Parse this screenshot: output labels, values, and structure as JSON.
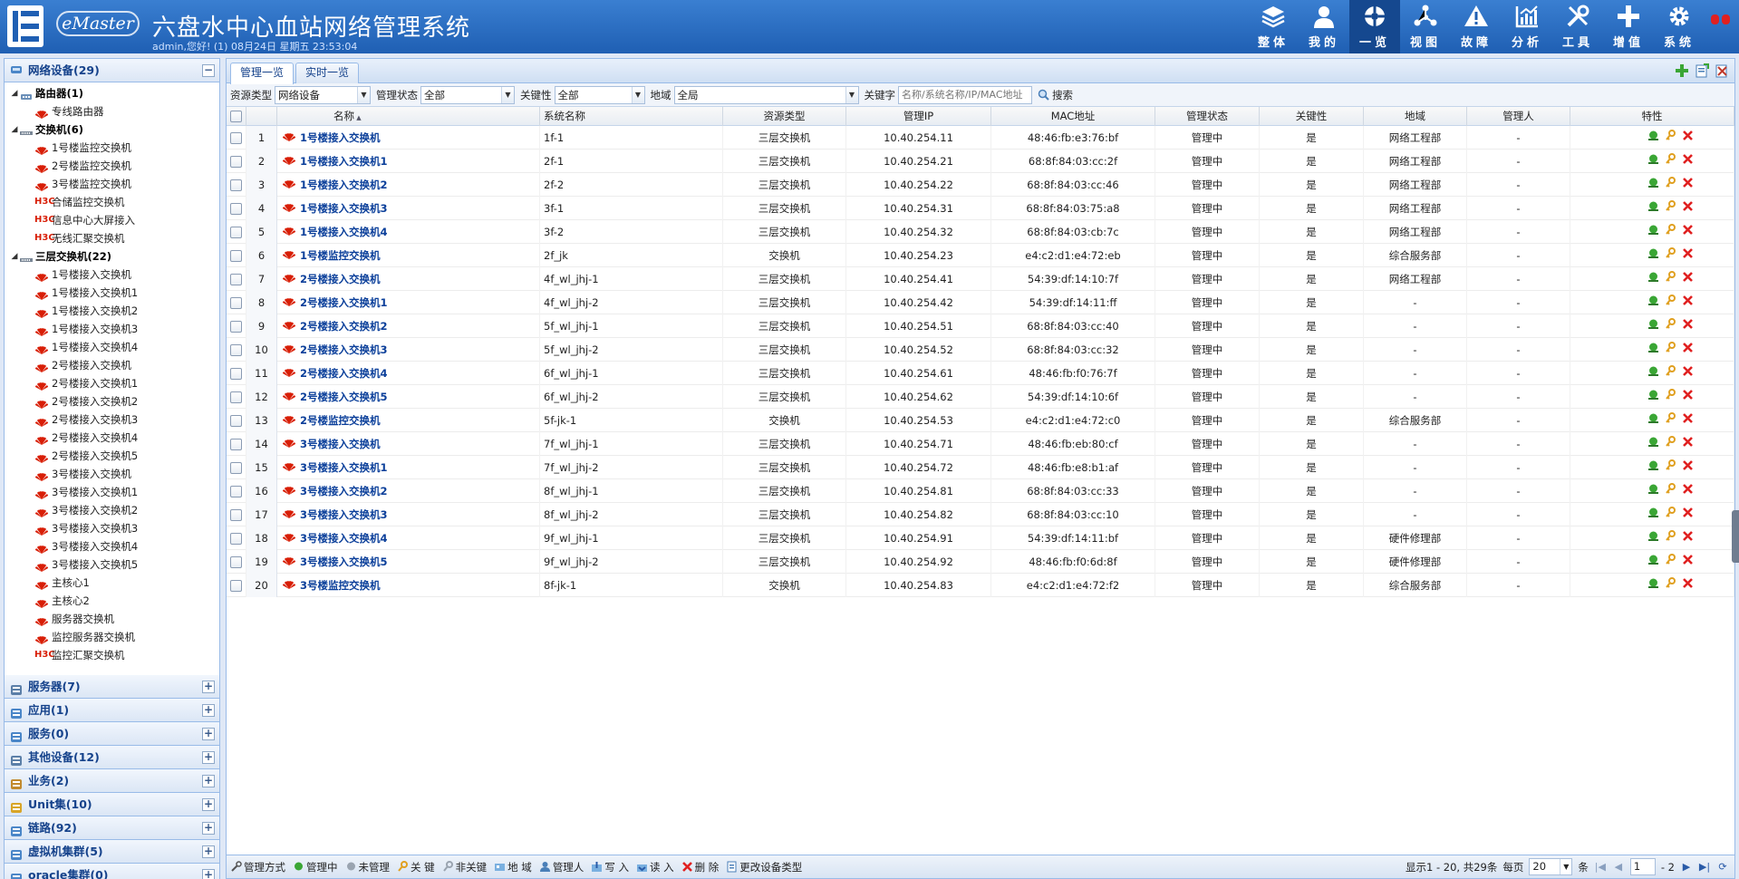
{
  "header": {
    "logo_text": "eMaster",
    "title": "六盘水中心血站网络管理系统",
    "user_info": "admin,您好! (1) 08月24日 星期五 23:53:04",
    "nav": [
      {
        "label": "整体",
        "icon": "layers-icon"
      },
      {
        "label": "我的",
        "icon": "user-icon"
      },
      {
        "label": "一览",
        "icon": "overview-icon",
        "active": true
      },
      {
        "label": "视图",
        "icon": "topology-icon"
      },
      {
        "label": "故障",
        "icon": "warning-icon"
      },
      {
        "label": "分析",
        "icon": "chart-icon"
      },
      {
        "label": "工具",
        "icon": "tools-icon"
      },
      {
        "label": "增值",
        "icon": "plus-icon"
      },
      {
        "label": "系统",
        "icon": "gear-icon"
      }
    ]
  },
  "sidebar": {
    "sections": [
      {
        "label": "网络设备(29)",
        "expanded": true
      },
      {
        "label": "服务器(7)"
      },
      {
        "label": "应用(1)"
      },
      {
        "label": "服务(0)"
      },
      {
        "label": "其他设备(12)"
      },
      {
        "label": "业务(2)"
      },
      {
        "label": "Unit集(10)"
      },
      {
        "label": "链路(92)"
      },
      {
        "label": "虚拟机集群(5)"
      },
      {
        "label": "oracle集群(0)"
      }
    ],
    "tree": [
      {
        "label": "路由器(1)",
        "type": "group",
        "icon": "router"
      },
      {
        "label": "专线路由器",
        "type": "leaf",
        "brand": "huawei"
      },
      {
        "label": "交换机(6)",
        "type": "group",
        "icon": "switch"
      },
      {
        "label": "1号楼监控交换机",
        "type": "leaf",
        "brand": "huawei"
      },
      {
        "label": "2号楼监控交换机",
        "type": "leaf",
        "brand": "huawei"
      },
      {
        "label": "3号楼监控交换机",
        "type": "leaf",
        "brand": "huawei"
      },
      {
        "label": "合储监控交换机",
        "type": "leaf",
        "brand": "h3c"
      },
      {
        "label": "信息中心大屏接入",
        "type": "leaf",
        "brand": "h3c"
      },
      {
        "label": "无线汇聚交换机",
        "type": "leaf",
        "brand": "h3c"
      },
      {
        "label": "三层交换机(22)",
        "type": "group",
        "icon": "switch"
      },
      {
        "label": "1号楼接入交换机",
        "type": "leaf",
        "brand": "huawei"
      },
      {
        "label": "1号楼接入交换机1",
        "type": "leaf",
        "brand": "huawei"
      },
      {
        "label": "1号楼接入交换机2",
        "type": "leaf",
        "brand": "huawei"
      },
      {
        "label": "1号楼接入交换机3",
        "type": "leaf",
        "brand": "huawei"
      },
      {
        "label": "1号楼接入交换机4",
        "type": "leaf",
        "brand": "huawei"
      },
      {
        "label": "2号楼接入交换机",
        "type": "leaf",
        "brand": "huawei"
      },
      {
        "label": "2号楼接入交换机1",
        "type": "leaf",
        "brand": "huawei"
      },
      {
        "label": "2号楼接入交换机2",
        "type": "leaf",
        "brand": "huawei"
      },
      {
        "label": "2号楼接入交换机3",
        "type": "leaf",
        "brand": "huawei"
      },
      {
        "label": "2号楼接入交换机4",
        "type": "leaf",
        "brand": "huawei"
      },
      {
        "label": "2号楼接入交换机5",
        "type": "leaf",
        "brand": "huawei"
      },
      {
        "label": "3号楼接入交换机",
        "type": "leaf",
        "brand": "huawei"
      },
      {
        "label": "3号楼接入交换机1",
        "type": "leaf",
        "brand": "huawei"
      },
      {
        "label": "3号楼接入交换机2",
        "type": "leaf",
        "brand": "huawei"
      },
      {
        "label": "3号楼接入交换机3",
        "type": "leaf",
        "brand": "huawei"
      },
      {
        "label": "3号楼接入交换机4",
        "type": "leaf",
        "brand": "huawei"
      },
      {
        "label": "3号楼接入交换机5",
        "type": "leaf",
        "brand": "huawei"
      },
      {
        "label": "主核心1",
        "type": "leaf",
        "brand": "huawei"
      },
      {
        "label": "主核心2",
        "type": "leaf",
        "brand": "huawei"
      },
      {
        "label": "服务器交换机",
        "type": "leaf",
        "brand": "huawei"
      },
      {
        "label": "监控服务器交换机",
        "type": "leaf",
        "brand": "huawei"
      },
      {
        "label": "监控汇聚交换机",
        "type": "leaf",
        "brand": "h3c"
      }
    ]
  },
  "tabs": [
    {
      "label": "管理一览",
      "active": true
    },
    {
      "label": "实时一览"
    }
  ],
  "filters": {
    "resource_type_label": "资源类型",
    "resource_type_value": "网络设备",
    "mgmt_state_label": "管理状态",
    "mgmt_state_value": "全部",
    "key_label": "关键性",
    "key_value": "全部",
    "region_label": "地域",
    "region_value": "全局",
    "keyword_label": "关键字",
    "keyword_placeholder": "名称/系统名称/IP/MAC地址",
    "search_label": "搜索"
  },
  "table": {
    "columns": [
      "名称",
      "系统名称",
      "资源类型",
      "管理IP",
      "MAC地址",
      "管理状态",
      "关键性",
      "地域",
      "管理人",
      "特性"
    ],
    "rows": [
      [
        "1号楼接入交换机",
        "1f-1",
        "三层交换机",
        "10.40.254.11",
        "48:46:fb:e3:76:bf",
        "管理中",
        "是",
        "网络工程部",
        "-"
      ],
      [
        "1号楼接入交换机1",
        "2f-1",
        "三层交换机",
        "10.40.254.21",
        "68:8f:84:03:cc:2f",
        "管理中",
        "是",
        "网络工程部",
        "-"
      ],
      [
        "1号楼接入交换机2",
        "2f-2",
        "三层交换机",
        "10.40.254.22",
        "68:8f:84:03:cc:46",
        "管理中",
        "是",
        "网络工程部",
        "-"
      ],
      [
        "1号楼接入交换机3",
        "3f-1",
        "三层交换机",
        "10.40.254.31",
        "68:8f:84:03:75:a8",
        "管理中",
        "是",
        "网络工程部",
        "-"
      ],
      [
        "1号楼接入交换机4",
        "3f-2",
        "三层交换机",
        "10.40.254.32",
        "68:8f:84:03:cb:7c",
        "管理中",
        "是",
        "网络工程部",
        "-"
      ],
      [
        "1号楼监控交换机",
        "2f_jk",
        "交换机",
        "10.40.254.23",
        "e4:c2:d1:e4:72:eb",
        "管理中",
        "是",
        "综合服务部",
        "-"
      ],
      [
        "2号楼接入交换机",
        "4f_wl_jhj-1",
        "三层交换机",
        "10.40.254.41",
        "54:39:df:14:10:7f",
        "管理中",
        "是",
        "网络工程部",
        "-"
      ],
      [
        "2号楼接入交换机1",
        "4f_wl_jhj-2",
        "三层交换机",
        "10.40.254.42",
        "54:39:df:14:11:ff",
        "管理中",
        "是",
        "-",
        "-"
      ],
      [
        "2号楼接入交换机2",
        "5f_wl_jhj-1",
        "三层交换机",
        "10.40.254.51",
        "68:8f:84:03:cc:40",
        "管理中",
        "是",
        "-",
        "-"
      ],
      [
        "2号楼接入交换机3",
        "5f_wl_jhj-2",
        "三层交换机",
        "10.40.254.52",
        "68:8f:84:03:cc:32",
        "管理中",
        "是",
        "-",
        "-"
      ],
      [
        "2号楼接入交换机4",
        "6f_wl_jhj-1",
        "三层交换机",
        "10.40.254.61",
        "48:46:fb:f0:76:7f",
        "管理中",
        "是",
        "-",
        "-"
      ],
      [
        "2号楼接入交换机5",
        "6f_wl_jhj-2",
        "三层交换机",
        "10.40.254.62",
        "54:39:df:14:10:6f",
        "管理中",
        "是",
        "-",
        "-"
      ],
      [
        "2号楼监控交换机",
        "5f-jk-1",
        "交换机",
        "10.40.254.53",
        "e4:c2:d1:e4:72:c0",
        "管理中",
        "是",
        "综合服务部",
        "-"
      ],
      [
        "3号楼接入交换机",
        "7f_wl_jhj-1",
        "三层交换机",
        "10.40.254.71",
        "48:46:fb:eb:80:cf",
        "管理中",
        "是",
        "-",
        "-"
      ],
      [
        "3号楼接入交换机1",
        "7f_wl_jhj-2",
        "三层交换机",
        "10.40.254.72",
        "48:46:fb:e8:b1:af",
        "管理中",
        "是",
        "-",
        "-"
      ],
      [
        "3号楼接入交换机2",
        "8f_wl_jhj-1",
        "三层交换机",
        "10.40.254.81",
        "68:8f:84:03:cc:33",
        "管理中",
        "是",
        "-",
        "-"
      ],
      [
        "3号楼接入交换机3",
        "8f_wl_jhj-2",
        "三层交换机",
        "10.40.254.82",
        "68:8f:84:03:cc:10",
        "管理中",
        "是",
        "-",
        "-"
      ],
      [
        "3号楼接入交换机4",
        "9f_wl_jhj-1",
        "三层交换机",
        "10.40.254.91",
        "54:39:df:14:11:bf",
        "管理中",
        "是",
        "硬件修理部",
        "-"
      ],
      [
        "3号楼接入交换机5",
        "9f_wl_jhj-2",
        "三层交换机",
        "10.40.254.92",
        "48:46:fb:f0:6d:8f",
        "管理中",
        "是",
        "硬件修理部",
        "-"
      ],
      [
        "3号楼监控交换机",
        "8f-jk-1",
        "交换机",
        "10.40.254.83",
        "e4:c2:d1:e4:72:f2",
        "管理中",
        "是",
        "综合服务部",
        "-"
      ]
    ]
  },
  "bottom_toolbar": [
    {
      "label": "管理方式",
      "icon": "wrench-icon"
    },
    {
      "label": "管理中",
      "icon": "managed-icon"
    },
    {
      "label": "未管理",
      "icon": "unmanaged-icon"
    },
    {
      "label": "关 键",
      "icon": "key-icon"
    },
    {
      "label": "非关键",
      "icon": "nonkey-icon"
    },
    {
      "label": "地 域",
      "icon": "region-icon"
    },
    {
      "label": "管理人",
      "icon": "manager-icon"
    },
    {
      "label": "写 入",
      "icon": "write-icon"
    },
    {
      "label": "读 入",
      "icon": "read-icon"
    },
    {
      "label": "删 除",
      "icon": "delete-icon"
    },
    {
      "label": "更改设备类型",
      "icon": "change-type-icon"
    }
  ],
  "pager": {
    "summary": "显示1 - 20, 共29条",
    "per_page_label": "每页",
    "per_page_value": "20",
    "per_page_unit": "条",
    "page_value": "1",
    "page_total": "- 2"
  },
  "colors": {
    "header_blue": "#1f5fb3",
    "link_blue": "#0b3f9a",
    "huawei_red": "#d81e06",
    "delete_red": "#e02020"
  }
}
